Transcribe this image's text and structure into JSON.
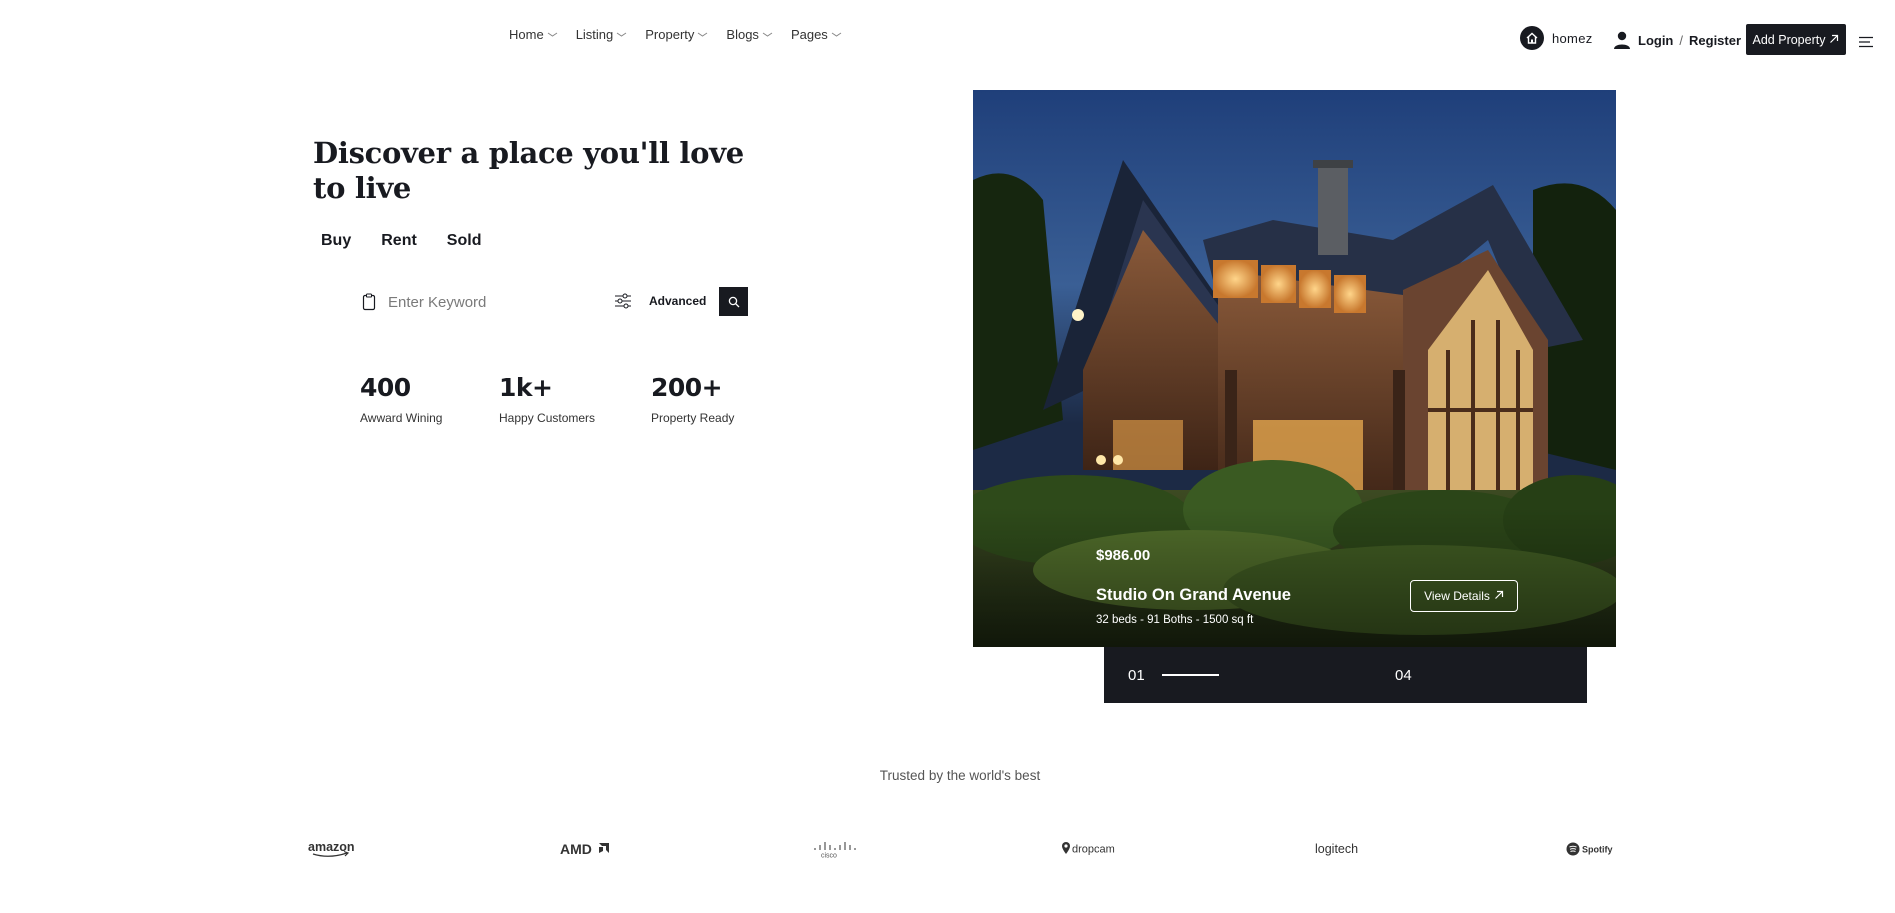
{
  "header": {
    "nav": [
      {
        "label": "Home"
      },
      {
        "label": "Listing"
      },
      {
        "label": "Property"
      },
      {
        "label": "Blogs"
      },
      {
        "label": "Pages"
      }
    ],
    "brand": "homez",
    "login": "Login",
    "slash": "/",
    "register": "Register",
    "add_property": "Add Property"
  },
  "hero": {
    "title": "Discover a place you'll love to live",
    "tabs": [
      {
        "label": "Buy"
      },
      {
        "label": "Rent"
      },
      {
        "label": "Sold"
      }
    ],
    "search": {
      "placeholder": "Enter Keyword",
      "advanced": "Advanced"
    },
    "stats": [
      {
        "value": "400",
        "label": "Awward Wining"
      },
      {
        "value": "1k+",
        "label": "Happy Customers"
      },
      {
        "value": "200+",
        "label": "Property Ready"
      }
    ]
  },
  "card": {
    "price": "$986.00",
    "title": "Studio On Grand Avenue",
    "meta": "32 beds - 91 Boths - 1500 sq ft",
    "details_label": "View Details"
  },
  "slider": {
    "current": "01",
    "total": "04"
  },
  "trusted": {
    "heading": "Trusted by the world's best",
    "logos": [
      "amazon",
      "AMD",
      "cisco",
      "dropcam",
      "logitech",
      "Spotify"
    ]
  },
  "colors": {
    "dark": "#181a20",
    "white": "#ffffff"
  }
}
